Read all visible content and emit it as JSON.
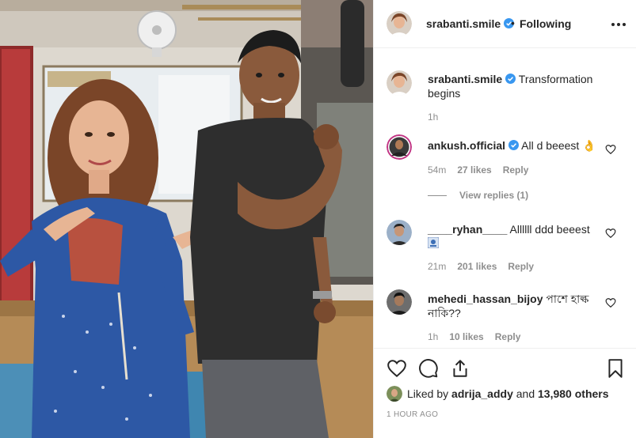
{
  "post": {
    "author": "srabanti.smile",
    "follow_status": "Following",
    "separator": "•",
    "caption": {
      "username": "srabanti.smile",
      "text": "Transformation begins",
      "time": "1h"
    }
  },
  "comments": [
    {
      "username": "ankush.official",
      "verified": true,
      "text": "All d beeest 👌",
      "time": "54m",
      "likes": "27 likes",
      "reply": "Reply",
      "view_replies": "View replies (1)"
    },
    {
      "username": "____ryhan____",
      "verified": false,
      "text": "Allllll ddd beeest",
      "time": "21m",
      "likes": "201 likes",
      "reply": "Reply"
    },
    {
      "username": "mehedi_hassan_bijoy",
      "verified": false,
      "text": "পাশে হাল্ক নাকি??",
      "time": "1h",
      "likes": "10 likes",
      "reply": "Reply"
    }
  ],
  "likes_summary": {
    "prefix": "Liked by",
    "user": "adrija_addy",
    "and": "and",
    "others": "13,980 others"
  },
  "timestamp": "1 HOUR AGO",
  "icons": [
    "verified-badge-icon",
    "more-options-icon",
    "heart-icon",
    "comment-icon",
    "share-icon",
    "bookmark-icon"
  ],
  "colors": {
    "verified_blue": "#3897f0",
    "text": "#262626",
    "muted": "#8e8e8e",
    "border": "#efefef"
  }
}
